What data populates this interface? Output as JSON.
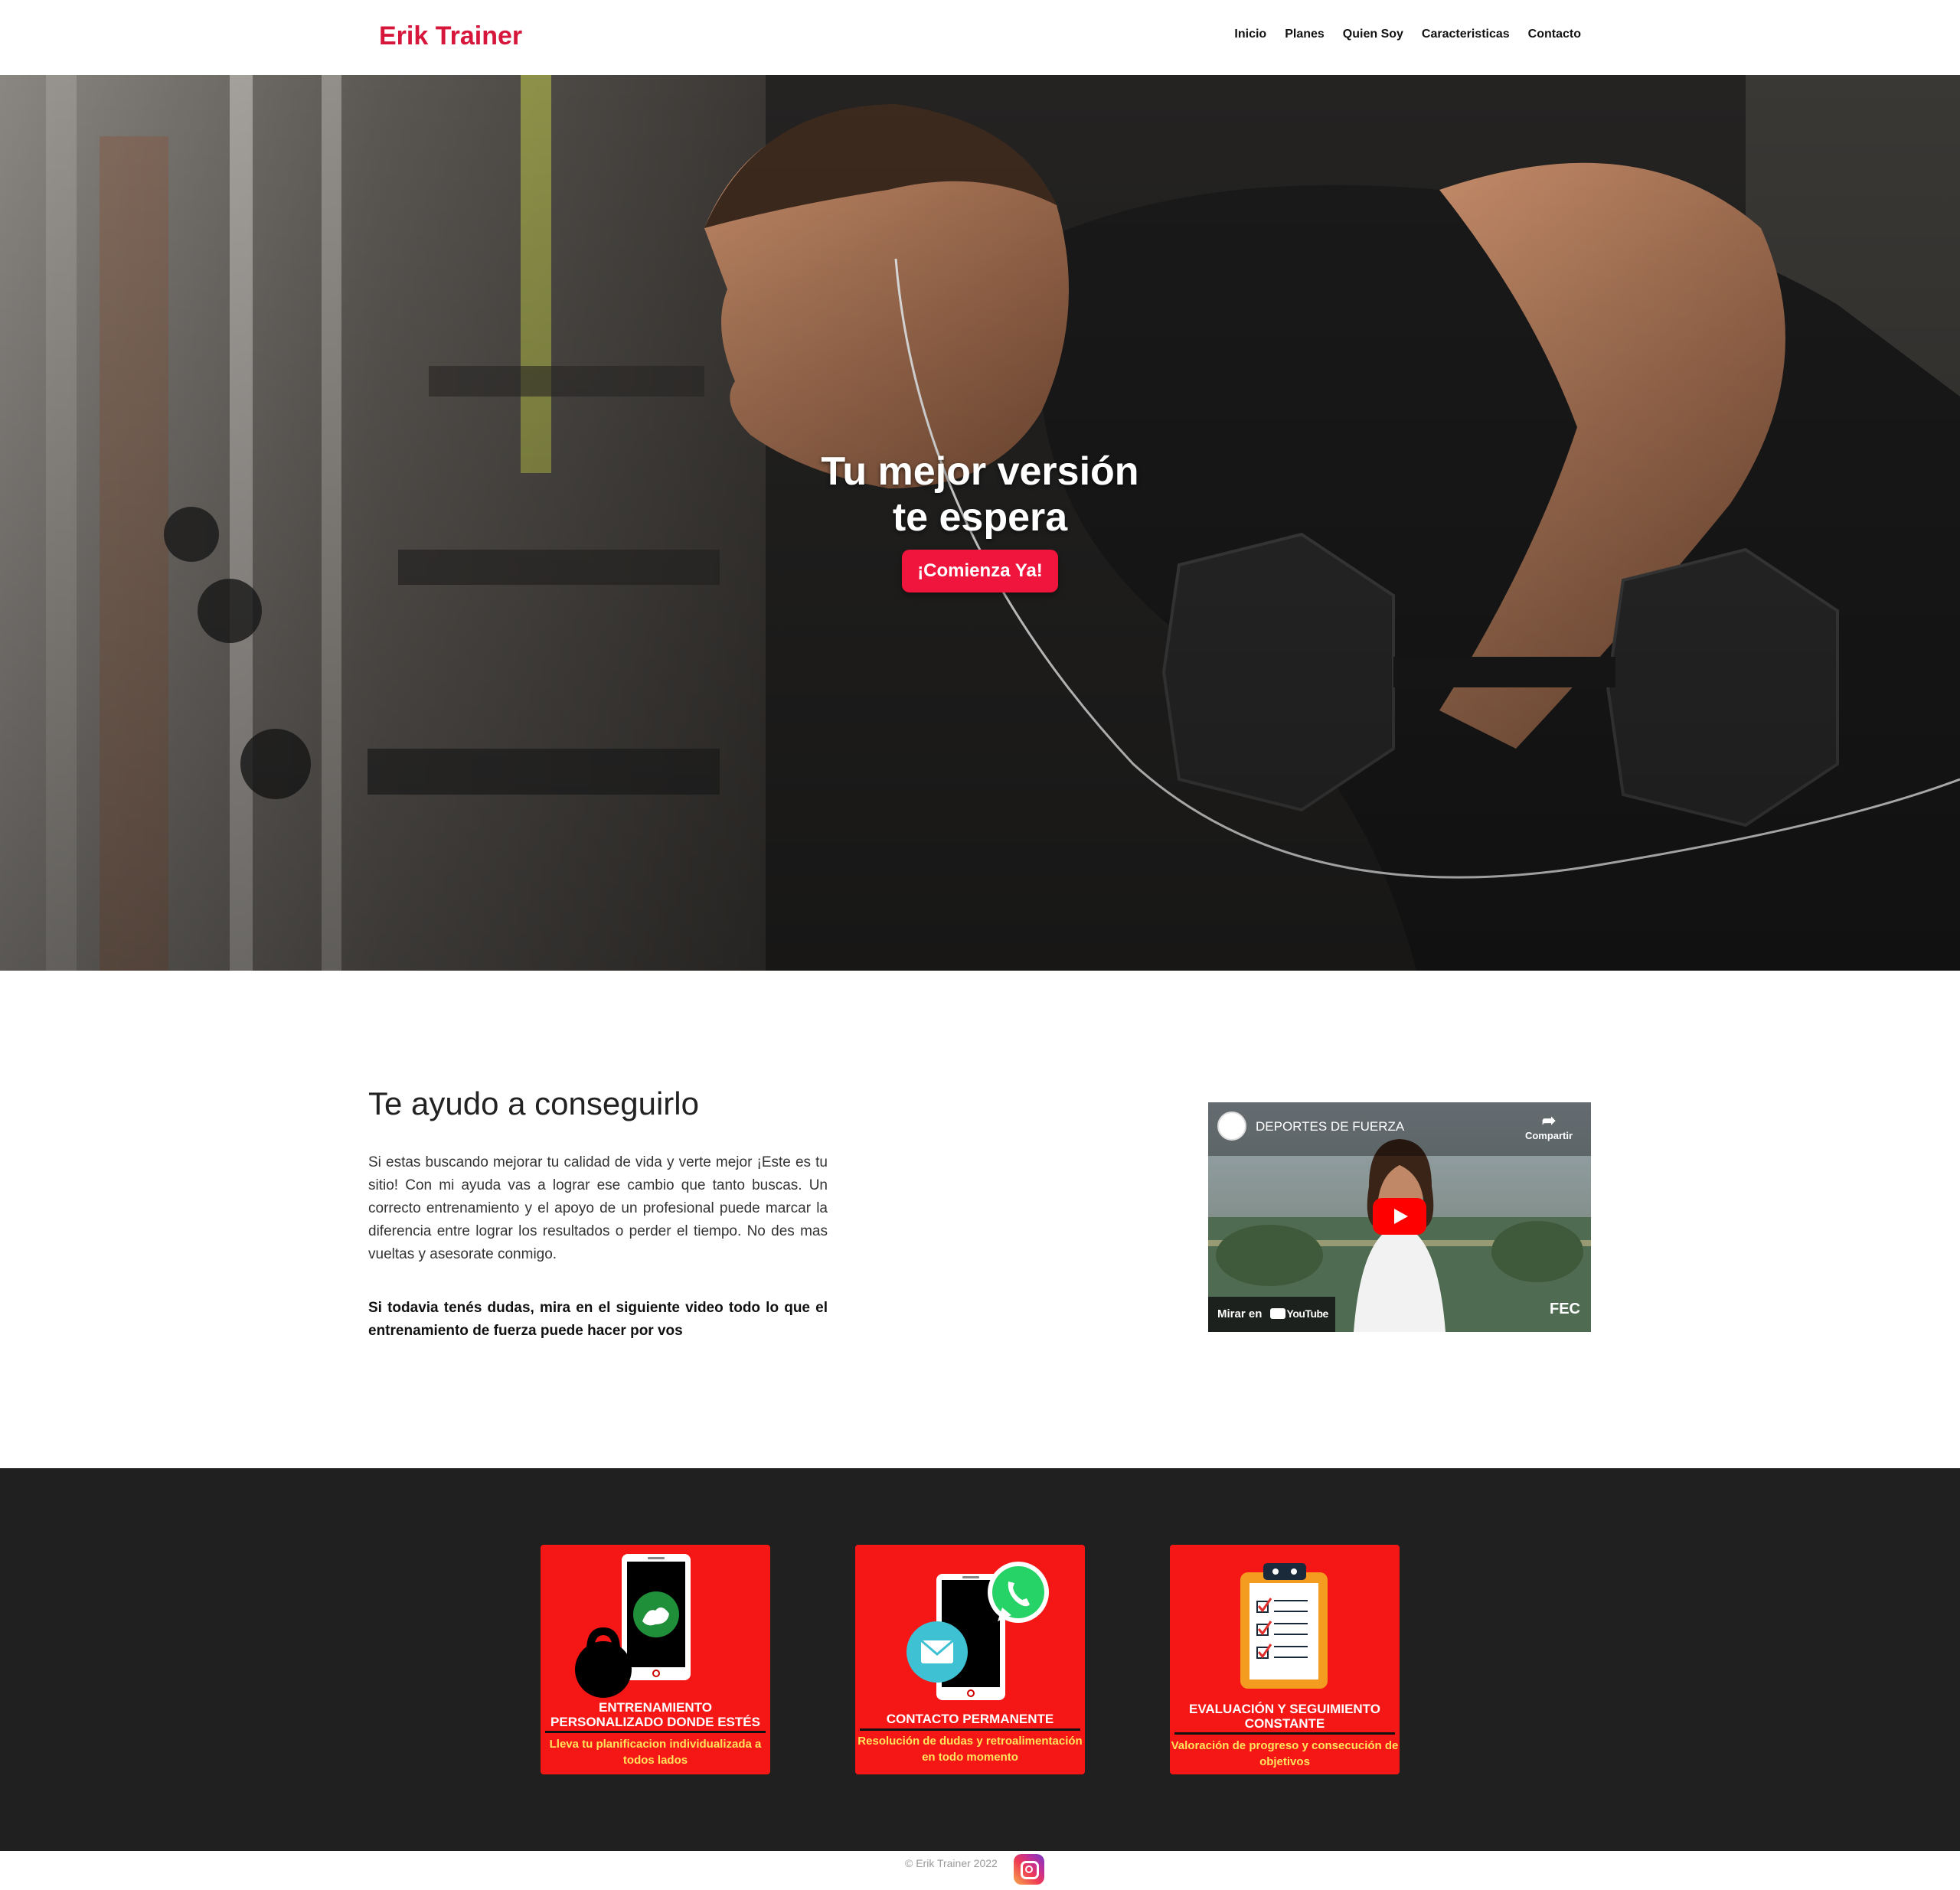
{
  "navbar": {
    "brand": "Erik Trainer",
    "links": [
      "Inicio",
      "Planes",
      "Quien Soy",
      "Caracteristicas",
      "Contacto"
    ]
  },
  "hero": {
    "title_line1": "Tu mejor versión",
    "title_line2": "te espera",
    "cta": "¡Comienza Ya!"
  },
  "about": {
    "title": "Te ayudo a conseguirlo",
    "paragraph": "Si estas buscando mejorar tu calidad de vida y verte mejor ¡Este es tu sitio! Con mi ayuda vas a lograr ese cambio que tanto buscas. Un correcto entrenamiento y el apoyo de un profesional puede marcar la diferencia entre lograr los resultados o perder el tiempo. No des mas vueltas y asesorate conmigo.",
    "emphasis": "Si todavia tenés dudas, mira en el siguiente video todo lo que el entrenamiento de fuerza puede hacer por vos"
  },
  "video": {
    "title": "DEPORTES DE FUERZA",
    "share": "Compartir",
    "watch_on": "Mirar en",
    "platform": "YouTube",
    "watermark": "FEC"
  },
  "features": [
    {
      "title": "ENTRENAMIENTO PERSONALIZADO DONDE ESTÉS",
      "subtitle": "Lleva tu planificacion individualizada a todos lados",
      "icon": "phone-kettlebell-icon"
    },
    {
      "title": "CONTACTO PERMANENTE",
      "subtitle": "Resolución de dudas y retroalimentación en todo momento",
      "icon": "phone-whatsapp-mail-icon"
    },
    {
      "title": "EVALUACIÓN Y SEGUIMIENTO CONSTANTE",
      "subtitle": "Valoración de progreso y consecución de objetivos",
      "icon": "clipboard-checklist-icon"
    }
  ],
  "footer": {
    "copyright": "© Erik Trainer 2022",
    "social_icon": "instagram-icon"
  },
  "colors": {
    "brand": "#d6163b",
    "cta": "#f0153c",
    "card_bg": "#f51616",
    "features_bg": "#202020"
  }
}
